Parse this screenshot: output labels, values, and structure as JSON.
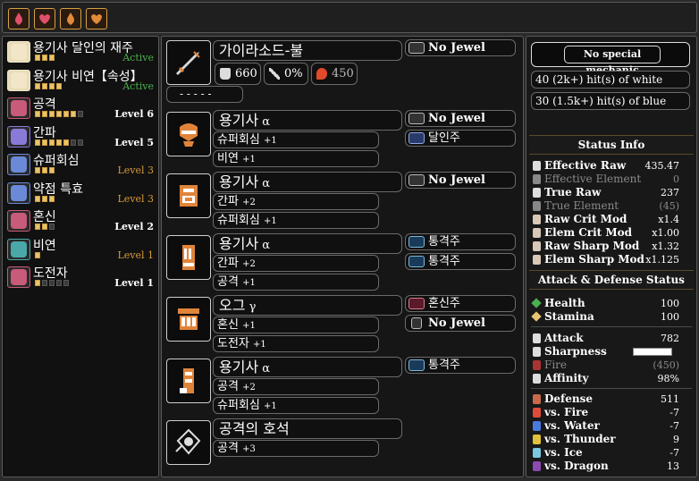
{
  "top_bar": {
    "icons": [
      {
        "name": "health-item-icon",
        "color": "#e0506a"
      },
      {
        "name": "health-boost-icon",
        "color": "#e0506a"
      },
      {
        "name": "attack-item-icon",
        "color": "#e08a3a"
      },
      {
        "name": "attack-boost-icon",
        "color": "#e08a3a"
      }
    ]
  },
  "skills": [
    {
      "name": "용기사 달인의 재주",
      "tag": "Active",
      "tag_color": "#4caf50",
      "pips_on": 3,
      "pips_total": 3,
      "icon_color": "#f2e6c8"
    },
    {
      "name": "용기사 비연【속성】",
      "tag": "Active",
      "tag_color": "#4caf50",
      "pips_on": 4,
      "pips_total": 4,
      "icon_color": "#f2e6c8"
    },
    {
      "name": "공격",
      "tag": "Level 6",
      "tag_color": "#ffffff",
      "pips_on": 6,
      "pips_total": 7,
      "icon_color": "#c85a7a"
    },
    {
      "name": "간파",
      "tag": "Level 5",
      "tag_color": "#ffffff",
      "pips_on": 5,
      "pips_total": 7,
      "icon_color": "#8a7ad8"
    },
    {
      "name": "슈퍼회심",
      "tag": "Level 3",
      "tag_color": "#d89a3a",
      "pips_on": 3,
      "pips_total": 3,
      "icon_color": "#6a8ad8"
    },
    {
      "name": "약점 특효",
      "tag": "Level 3",
      "tag_color": "#d89a3a",
      "pips_on": 3,
      "pips_total": 3,
      "icon_color": "#6a8ad8"
    },
    {
      "name": "혼신",
      "tag": "Level 2",
      "tag_color": "#ffffff",
      "pips_on": 2,
      "pips_total": 3,
      "icon_color": "#c85a7a"
    },
    {
      "name": "비연",
      "tag": "Level 1",
      "tag_color": "#d89a3a",
      "pips_on": 1,
      "pips_total": 1,
      "icon_color": "#4aa8a8"
    },
    {
      "name": "도전자",
      "tag": "Level 1",
      "tag_color": "#ffffff",
      "pips_on": 1,
      "pips_total": 5,
      "icon_color": "#c85a7a"
    }
  ],
  "weapon": {
    "name": "가이라소드-불",
    "jewel": "No Jewel",
    "raw": "660",
    "affinity": "0%",
    "element": "450",
    "rampage": "- - - - -"
  },
  "armor": [
    {
      "slot": "head",
      "name": "용기사",
      "rank": "α",
      "skills": [
        {
          "name": "슈퍼회심",
          "lv": "+1"
        },
        {
          "name": "비연",
          "lv": "+1"
        }
      ],
      "jewels": [
        {
          "label": "No Jewel",
          "kind": "empty"
        },
        {
          "label": "달인주",
          "kind": "blue"
        }
      ]
    },
    {
      "slot": "chest",
      "name": "용기사",
      "rank": "α",
      "skills": [
        {
          "name": "간파",
          "lv": "+2"
        },
        {
          "name": "슈퍼회심",
          "lv": "+1"
        }
      ],
      "jewels": [
        {
          "label": "No Jewel",
          "kind": "empty"
        }
      ]
    },
    {
      "slot": "arms",
      "name": "용기사",
      "rank": "α",
      "skills": [
        {
          "name": "간파",
          "lv": "+2"
        },
        {
          "name": "공격",
          "lv": "+1"
        }
      ],
      "jewels": [
        {
          "label": "통격주",
          "kind": "teal"
        },
        {
          "label": "통격주",
          "kind": "teal"
        }
      ]
    },
    {
      "slot": "waist",
      "name": "오그",
      "rank": "γ",
      "skills": [
        {
          "name": "혼신",
          "lv": "+1"
        },
        {
          "name": "도전자",
          "lv": "+1"
        }
      ],
      "jewels": [
        {
          "label": "혼신주",
          "kind": "red"
        },
        {
          "label": "No Jewel",
          "kind": "empty-small"
        }
      ]
    },
    {
      "slot": "legs",
      "name": "용기사",
      "rank": "α",
      "skills": [
        {
          "name": "공격",
          "lv": "+2"
        },
        {
          "name": "슈퍼회심",
          "lv": "+1"
        }
      ],
      "jewels": [
        {
          "label": "통격주",
          "kind": "teal"
        }
      ]
    },
    {
      "slot": "charm",
      "name": "공격의 호석",
      "rank": "",
      "skills": [
        {
          "name": "공격",
          "lv": "+3"
        }
      ],
      "jewels": []
    }
  ],
  "right": {
    "mechanic": "No special mechanic",
    "hits": [
      "40 (2k+) hit(s) of white",
      "30 (1.5k+) hit(s) of blue"
    ],
    "status_info_title": "Status Info",
    "status_info": [
      {
        "label": "Effective Raw",
        "value": "435.47",
        "dim": false
      },
      {
        "label": "Effective Element",
        "value": "0",
        "dim": true
      },
      {
        "label": "True Raw",
        "value": "237",
        "dim": false
      },
      {
        "label": "True Element",
        "value": "(45)",
        "dim": true
      },
      {
        "label": "Raw Crit Mod",
        "value": "x1.4",
        "dim": false
      },
      {
        "label": "Elem Crit Mod",
        "value": "x1.00",
        "dim": false
      },
      {
        "label": "Raw Sharp Mod",
        "value": "x1.32",
        "dim": false
      },
      {
        "label": "Elem Sharp Mod",
        "value": "x1.125",
        "dim": false
      }
    ],
    "ad_title": "Attack & Defense Status",
    "vitals": [
      {
        "label": "Health",
        "value": "100",
        "color": "#4caf50"
      },
      {
        "label": "Stamina",
        "value": "100",
        "color": "#e8c470"
      }
    ],
    "attack": [
      {
        "label": "Attack",
        "value": "782",
        "dim": false
      },
      {
        "label": "Sharpness",
        "value": "",
        "dim": false
      },
      {
        "label": "Fire",
        "value": "(450)",
        "dim": true
      },
      {
        "label": "Affinity",
        "value": "98%",
        "dim": false
      }
    ],
    "defense": [
      {
        "label": "Defense",
        "value": "511",
        "color": "#c86a4a"
      },
      {
        "label": "vs. Fire",
        "value": "-7",
        "color": "#e04a3a"
      },
      {
        "label": "vs. Water",
        "value": "-7",
        "color": "#4a7ae0"
      },
      {
        "label": "vs. Thunder",
        "value": "9",
        "color": "#e0c03a"
      },
      {
        "label": "vs. Ice",
        "value": "-7",
        "color": "#7ac8e0"
      },
      {
        "label": "vs. Dragon",
        "value": "13",
        "color": "#8a4ab0"
      }
    ]
  }
}
